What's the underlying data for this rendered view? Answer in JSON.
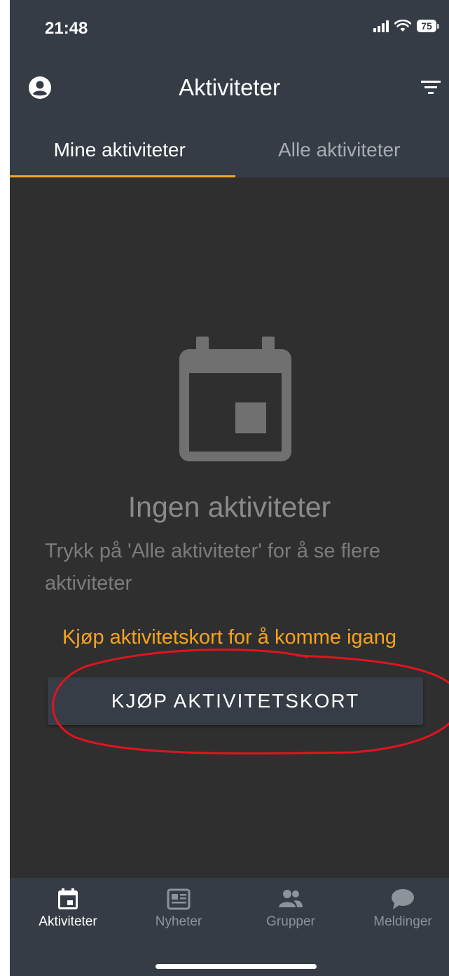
{
  "status_bar": {
    "time": "21:48",
    "battery": "75",
    "icons": [
      "signal-icon",
      "wifi-icon",
      "battery-icon"
    ]
  },
  "header": {
    "title": "Aktiviteter",
    "left_icon": "profile-icon",
    "right_icon": "filter-icon"
  },
  "tabs": [
    {
      "label": "Mine aktiviteter",
      "active": true
    },
    {
      "label": "Alle aktiviteter",
      "active": false
    }
  ],
  "empty_state": {
    "icon": "calendar-icon",
    "title": "Ingen aktiviteter",
    "description": "Trykk på 'Alle aktiviteter' for å se flere aktiviteter",
    "promo": "Kjøp aktivitetskort for å komme igang",
    "button_label": "KJØP AKTIVITETSKORT"
  },
  "bottom_nav": [
    {
      "label": "Aktiviteter",
      "icon": "calendar-icon",
      "active": true
    },
    {
      "label": "Nyheter",
      "icon": "news-icon",
      "active": false
    },
    {
      "label": "Grupper",
      "icon": "groups-icon",
      "active": false
    },
    {
      "label": "Meldinger",
      "icon": "chat-icon",
      "active": false
    }
  ],
  "colors": {
    "header_bg": "#353c45",
    "content_bg": "#2f2f2f",
    "accent": "#f5a623",
    "annotation": "#e0141e"
  }
}
